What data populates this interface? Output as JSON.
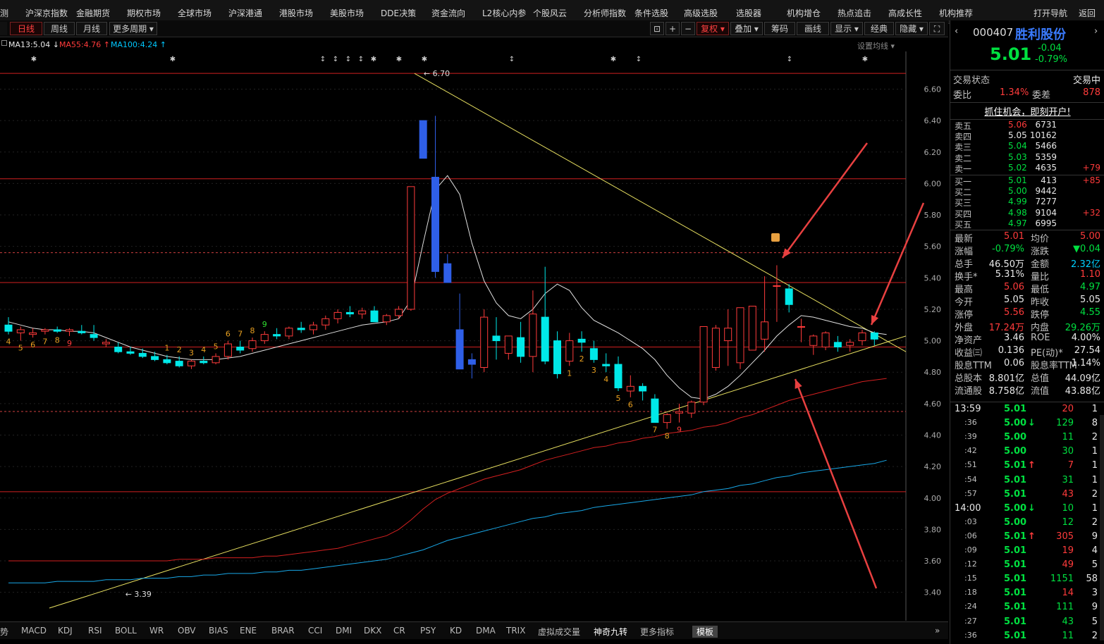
{
  "menu": [
    "测",
    "沪深京指数",
    "金融期货",
    "期权市场",
    "全球市场",
    "沪深港通",
    "港股市场",
    "美股市场",
    "DDE决策",
    "资金流向",
    "L2核心内参",
    "个股风云",
    "分析师指数",
    "条件选股",
    "高级选股",
    "选股器",
    "机构增仓",
    "热点追击",
    "高成长性",
    "机构推荐",
    "打开导航",
    "返回"
  ],
  "toolbar": {
    "periods": [
      "日线",
      "周线",
      "月线",
      "更多周期"
    ],
    "right_tools": [
      "复权",
      "叠加",
      "筹码",
      "画线",
      "显示",
      "经典",
      "隐藏"
    ],
    "settings_label": "设置均线"
  },
  "ma_legend": [
    {
      "label": "MA13:5.04",
      "color": "#e8e8e8",
      "arrow": "↓"
    },
    {
      "label": "MA55:4.76",
      "color": "#ff3b3b",
      "arrow": "↑"
    },
    {
      "label": "MA100:4.24",
      "color": "#00c8ff",
      "arrow": "↑"
    }
  ],
  "chart_data": {
    "type": "candlestick",
    "ylim": [
      3.3,
      6.75
    ],
    "y_ticks": [
      "6.60",
      "6.40",
      "6.20",
      "6.00",
      "5.80",
      "5.60",
      "5.40",
      "5.20",
      "5.00",
      "4.80",
      "4.60",
      "4.40",
      "4.20",
      "4.00",
      "3.80",
      "3.60",
      "3.40"
    ],
    "annotations": [
      "6.70",
      "3.39"
    ],
    "candles": [
      [
        5.1,
        5.15,
        5.04,
        5.06
      ],
      [
        5.05,
        5.09,
        5.0,
        5.07
      ],
      [
        5.04,
        5.08,
        5.02,
        5.05
      ],
      [
        5.06,
        5.08,
        5.04,
        5.07
      ],
      [
        5.07,
        5.09,
        5.05,
        5.06
      ],
      [
        5.06,
        5.08,
        5.03,
        5.07
      ],
      [
        5.06,
        5.1,
        5.04,
        5.05
      ],
      [
        5.04,
        5.1,
        5.0,
        5.02
      ],
      [
        4.98,
        5.01,
        4.96,
        4.99
      ],
      [
        4.96,
        4.99,
        4.92,
        4.93
      ],
      [
        4.93,
        4.96,
        4.91,
        4.92
      ],
      [
        4.92,
        4.95,
        4.89,
        4.9
      ],
      [
        4.9,
        4.93,
        4.87,
        4.88
      ],
      [
        4.88,
        4.91,
        4.85,
        4.86
      ],
      [
        4.87,
        4.9,
        4.83,
        4.84
      ],
      [
        4.84,
        4.88,
        4.82,
        4.87
      ],
      [
        4.87,
        4.9,
        4.85,
        4.86
      ],
      [
        4.86,
        4.92,
        4.85,
        4.9
      ],
      [
        4.9,
        5.0,
        4.88,
        4.98
      ],
      [
        4.96,
        5.0,
        4.92,
        4.94
      ],
      [
        4.95,
        5.02,
        4.93,
        5.0
      ],
      [
        5.0,
        5.06,
        4.98,
        5.04
      ],
      [
        5.04,
        5.08,
        5.01,
        5.03
      ],
      [
        5.03,
        5.09,
        5.01,
        5.08
      ],
      [
        5.08,
        5.12,
        5.05,
        5.07
      ],
      [
        5.07,
        5.12,
        5.04,
        5.1
      ],
      [
        5.1,
        5.16,
        5.07,
        5.14
      ],
      [
        5.14,
        5.2,
        5.11,
        5.18
      ],
      [
        5.18,
        5.22,
        5.15,
        5.17
      ],
      [
        5.17,
        5.21,
        5.14,
        5.19
      ],
      [
        5.19,
        5.22,
        5.16,
        5.12
      ],
      [
        5.12,
        5.17,
        5.1,
        5.16
      ],
      [
        5.16,
        5.22,
        5.14,
        5.2
      ],
      [
        5.2,
        5.98,
        5.19,
        5.98
      ],
      [
        6.4,
        6.4,
        6.16,
        6.16
      ],
      [
        6.04,
        6.43,
        5.4,
        5.44
      ],
      [
        5.49,
        5.55,
        5.37,
        5.37
      ],
      [
        5.07,
        5.3,
        4.82,
        4.82
      ],
      [
        4.88,
        4.92,
        4.76,
        4.85
      ],
      [
        4.83,
        5.2,
        4.8,
        5.15
      ],
      [
        5.03,
        5.15,
        4.88,
        5.0
      ],
      [
        4.92,
        5.03,
        4.88,
        5.03
      ],
      [
        5.02,
        5.12,
        4.86,
        4.9
      ],
      [
        4.9,
        5.32,
        4.8,
        5.17
      ],
      [
        5.15,
        5.47,
        4.85,
        4.87
      ],
      [
        5.0,
        5.06,
        4.76,
        4.79
      ],
      [
        4.87,
        5.05,
        4.84,
        5.0
      ],
      [
        5.01,
        5.06,
        4.93,
        4.99
      ],
      [
        4.95,
        5.0,
        4.86,
        4.88
      ],
      [
        4.85,
        4.92,
        4.8,
        4.84
      ],
      [
        4.85,
        4.9,
        4.68,
        4.7
      ],
      [
        4.68,
        4.78,
        4.64,
        4.71
      ],
      [
        4.71,
        4.73,
        4.62,
        4.68
      ],
      [
        4.63,
        4.66,
        4.48,
        4.48
      ],
      [
        4.48,
        4.54,
        4.44,
        4.53
      ],
      [
        4.54,
        4.6,
        4.48,
        4.55
      ],
      [
        4.54,
        4.62,
        4.51,
        4.61
      ],
      [
        4.61,
        5.09,
        4.59,
        5.09
      ],
      [
        4.83,
        5.1,
        4.81,
        5.08
      ],
      [
        5.0,
        5.2,
        4.84,
        5.08
      ],
      [
        4.86,
        5.21,
        4.82,
        5.21
      ],
      [
        4.94,
        5.21,
        4.94,
        5.22
      ],
      [
        5.01,
        5.41,
        4.93,
        5.12
      ],
      [
        5.35,
        5.48,
        5.12,
        5.35
      ],
      [
        5.33,
        5.36,
        5.18,
        5.23
      ],
      [
        5.09,
        5.14,
        4.99,
        5.09
      ],
      [
        4.97,
        5.04,
        4.91,
        5.03
      ],
      [
        4.96,
        5.06,
        4.94,
        5.05
      ],
      [
        4.99,
        5.03,
        4.93,
        4.96
      ],
      [
        4.97,
        5.01,
        4.93,
        4.99
      ],
      [
        5.0,
        5.07,
        4.97,
        5.05
      ],
      [
        5.05,
        5.06,
        4.97,
        5.01
      ]
    ],
    "ma13": [
      5.12,
      5.1,
      5.08,
      5.07,
      5.07,
      5.06,
      5.06,
      5.05,
      5.02,
      4.99,
      4.96,
      4.94,
      4.92,
      4.9,
      4.89,
      4.88,
      4.88,
      4.88,
      4.89,
      4.9,
      4.92,
      4.94,
      4.96,
      4.98,
      5.0,
      5.02,
      5.04,
      5.06,
      5.08,
      5.1,
      5.11,
      5.12,
      5.14,
      5.26,
      5.62,
      5.96,
      6.05,
      5.93,
      5.62,
      5.38,
      5.24,
      5.16,
      5.14,
      5.2,
      5.3,
      5.36,
      5.32,
      5.21,
      5.13,
      5.09,
      5.05,
      5.0,
      4.95,
      4.88,
      4.78,
      4.7,
      4.64,
      4.63,
      4.66,
      4.71,
      4.78,
      4.86,
      4.94,
      5.03,
      5.1,
      5.16,
      5.15,
      5.13,
      5.11,
      5.09,
      5.08,
      5.05,
      5.04
    ],
    "ma55": [
      3.6,
      3.6,
      3.6,
      3.6,
      3.6,
      3.6,
      3.6,
      3.6,
      3.6,
      3.6,
      3.6,
      3.6,
      3.6,
      3.6,
      3.61,
      3.61,
      3.61,
      3.62,
      3.62,
      3.62,
      3.62,
      3.63,
      3.63,
      3.64,
      3.65,
      3.66,
      3.67,
      3.68,
      3.7,
      3.72,
      3.74,
      3.76,
      3.8,
      3.86,
      3.93,
      3.99,
      4.03,
      4.06,
      4.09,
      4.12,
      4.14,
      4.16,
      4.18,
      4.21,
      4.24,
      4.26,
      4.28,
      4.3,
      4.32,
      4.33,
      4.35,
      4.36,
      4.38,
      4.39,
      4.41,
      4.42,
      4.43,
      4.45,
      4.46,
      4.48,
      4.51,
      4.53,
      4.56,
      4.59,
      4.62,
      4.64,
      4.66,
      4.68,
      4.7,
      4.72,
      4.74,
      4.75,
      4.76
    ],
    "ma100": [
      3.46,
      3.46,
      3.46,
      3.46,
      3.47,
      3.47,
      3.47,
      3.47,
      3.48,
      3.48,
      3.48,
      3.49,
      3.49,
      3.49,
      3.5,
      3.5,
      3.51,
      3.51,
      3.52,
      3.52,
      3.52,
      3.53,
      3.53,
      3.54,
      3.54,
      3.55,
      3.56,
      3.57,
      3.58,
      3.59,
      3.6,
      3.61,
      3.63,
      3.65,
      3.67,
      3.7,
      3.73,
      3.75,
      3.77,
      3.79,
      3.81,
      3.83,
      3.85,
      3.87,
      3.88,
      3.9,
      3.91,
      3.92,
      3.94,
      3.95,
      3.96,
      3.97,
      3.98,
      3.99,
      4.0,
      4.01,
      4.02,
      4.04,
      4.05,
      4.06,
      4.08,
      4.09,
      4.11,
      4.13,
      4.14,
      4.16,
      4.17,
      4.18,
      4.19,
      4.2,
      4.21,
      4.22,
      4.24
    ],
    "levels": [
      6.7,
      6.03,
      5.37,
      4.96,
      4.04
    ],
    "dashed_levels": [
      5.56,
      4.55
    ],
    "trendlines": [
      [
        6.7,
        4.93
      ],
      [
        3.3,
        5.03
      ]
    ],
    "td_labels": [
      {
        "i": 0,
        "t": "4",
        "pos": "low"
      },
      {
        "i": 1,
        "t": "5",
        "pos": "low"
      },
      {
        "i": 2,
        "t": "6",
        "pos": "low"
      },
      {
        "i": 3,
        "t": "7",
        "pos": "low"
      },
      {
        "i": 4,
        "t": "8",
        "pos": "low"
      },
      {
        "i": 5,
        "t": "9",
        "pos": "low"
      },
      {
        "i": 13,
        "t": "1",
        "pos": "high"
      },
      {
        "i": 14,
        "t": "2",
        "pos": "high"
      },
      {
        "i": 15,
        "t": "3",
        "pos": "high"
      },
      {
        "i": 16,
        "t": "4",
        "pos": "high"
      },
      {
        "i": 17,
        "t": "5",
        "pos": "high"
      },
      {
        "i": 18,
        "t": "6",
        "pos": "high"
      },
      {
        "i": 19,
        "t": "7",
        "pos": "high"
      },
      {
        "i": 20,
        "t": "8",
        "pos": "high"
      },
      {
        "i": 21,
        "t": "9",
        "pos": "high"
      },
      {
        "i": 46,
        "t": "1",
        "pos": "low"
      },
      {
        "i": 47,
        "t": "2",
        "pos": "low"
      },
      {
        "i": 48,
        "t": "3",
        "pos": "low"
      },
      {
        "i": 49,
        "t": "4",
        "pos": "low"
      },
      {
        "i": 50,
        "t": "5",
        "pos": "low"
      },
      {
        "i": 51,
        "t": "6",
        "pos": "low"
      },
      {
        "i": 53,
        "t": "7",
        "pos": "low"
      },
      {
        "i": 54,
        "t": "8",
        "pos": "low"
      },
      {
        "i": 55,
        "t": "9",
        "pos": "low"
      }
    ]
  },
  "indicators": [
    "势",
    "MACD",
    "KDJ",
    "RSI",
    "BOLL",
    "WR",
    "OBV",
    "BIAS",
    "ENE",
    "BRAR",
    "CCI",
    "DMI",
    "DKX",
    "CR",
    "PSY",
    "KD",
    "DMA",
    "TRIX",
    "虚拟成交量",
    "神奇九转",
    "更多指标",
    "模板"
  ],
  "stock": {
    "code": "000407",
    "name": "胜利股份",
    "price": "5.01",
    "change": "-0.04",
    "pct": "-0.79%"
  },
  "status": {
    "label": "交易状态",
    "value": "交易中",
    "wb_label": "委比",
    "wb": "1.34%",
    "wc_label": "委差",
    "wc": "878",
    "banner": "抓住机会，即刻开户!"
  },
  "asks": [
    [
      "卖五",
      "5.06",
      "6731",
      ""
    ],
    [
      "卖四",
      "5.05",
      "10162",
      ""
    ],
    [
      "卖三",
      "5.04",
      "5466",
      ""
    ],
    [
      "卖二",
      "5.03",
      "5359",
      ""
    ],
    [
      "卖一",
      "5.02",
      "4635",
      "+79"
    ]
  ],
  "bids": [
    [
      "买一",
      "5.01",
      "413",
      "+85"
    ],
    [
      "买二",
      "5.00",
      "9442",
      ""
    ],
    [
      "买三",
      "4.99",
      "7277",
      ""
    ],
    [
      "买四",
      "4.98",
      "9104",
      "+32"
    ],
    [
      "买五",
      "4.97",
      "6995",
      ""
    ]
  ],
  "quote": [
    [
      "最新",
      "5.01",
      "red",
      "均价",
      "5.00",
      "red"
    ],
    [
      "涨幅",
      "-0.79%",
      "green",
      "涨跌",
      "▼0.04",
      "green"
    ],
    [
      "总手",
      "46.50万",
      "white",
      "金额",
      "2.32亿",
      "cyan"
    ],
    [
      "换手*",
      "5.31%",
      "white",
      "量比",
      "1.10",
      "red"
    ],
    [
      "最高",
      "5.06",
      "red",
      "最低",
      "4.97",
      "green"
    ],
    [
      "今开",
      "5.05",
      "white",
      "昨收",
      "5.05",
      "white"
    ],
    [
      "涨停",
      "5.56",
      "red",
      "跌停",
      "4.55",
      "green"
    ],
    [
      "外盘",
      "17.24万",
      "red",
      "内盘",
      "29.26万",
      "green"
    ],
    [
      "净资产",
      "3.46",
      "white",
      "ROE",
      "4.00%",
      "white"
    ],
    [
      "收益㈢",
      "0.136",
      "white",
      "PE(动)*",
      "27.54",
      "white"
    ],
    [
      "股息TTM",
      "0.06",
      "white",
      "股息率TTM",
      "1.14%",
      "white"
    ],
    [
      "总股本",
      "8.801亿",
      "white",
      "总值",
      "44.09亿",
      "white"
    ],
    [
      "流通股",
      "8.758亿",
      "white",
      "流值",
      "43.88亿",
      "white"
    ]
  ],
  "ticks": [
    [
      "13:59",
      "5.01",
      "",
      "20",
      "1",
      "red"
    ],
    [
      ":36",
      "5.00",
      "↓",
      "129",
      "8",
      "green"
    ],
    [
      ":39",
      "5.00",
      "",
      "11",
      "2",
      "green"
    ],
    [
      ":42",
      "5.00",
      "",
      "30",
      "1",
      "green"
    ],
    [
      ":51",
      "5.01",
      "↑",
      "7",
      "1",
      "red"
    ],
    [
      ":54",
      "5.01",
      "",
      "31",
      "1",
      "green"
    ],
    [
      ":57",
      "5.01",
      "",
      "43",
      "2",
      "red"
    ],
    [
      "14:00",
      "5.00",
      "↓",
      "10",
      "1",
      "green"
    ],
    [
      ":03",
      "5.00",
      "",
      "12",
      "2",
      "green"
    ],
    [
      ":06",
      "5.01",
      "↑",
      "305",
      "9",
      "red"
    ],
    [
      ":09",
      "5.01",
      "",
      "19",
      "4",
      "red"
    ],
    [
      ":12",
      "5.01",
      "",
      "49",
      "5",
      "red"
    ],
    [
      ":15",
      "5.01",
      "",
      "1151",
      "58",
      "green"
    ],
    [
      ":18",
      "5.01",
      "",
      "14",
      "3",
      "red"
    ],
    [
      ":24",
      "5.01",
      "",
      "111",
      "9",
      "green"
    ],
    [
      ":27",
      "5.01",
      "",
      "43",
      "5",
      "green"
    ],
    [
      ":36",
      "5.01",
      "",
      "11",
      "2",
      "green"
    ]
  ]
}
